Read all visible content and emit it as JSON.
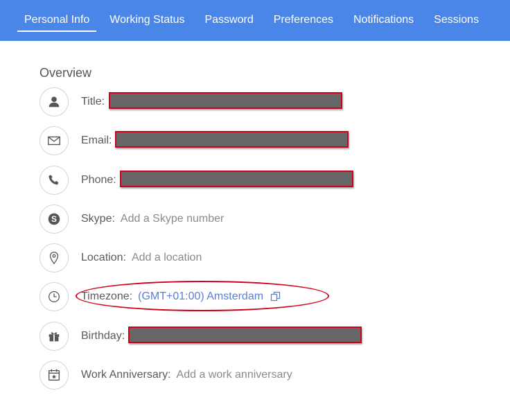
{
  "tabs": [
    {
      "label": "Personal Info",
      "active": true
    },
    {
      "label": "Working Status",
      "active": false
    },
    {
      "label": "Password",
      "active": false
    },
    {
      "label": "Preferences",
      "active": false
    },
    {
      "label": "Notifications",
      "active": false
    },
    {
      "label": "Sessions",
      "active": false
    }
  ],
  "overview": {
    "title": "Overview",
    "rows": {
      "title": {
        "label": "Title:",
        "icon": "person-icon"
      },
      "email": {
        "label": "Email:",
        "icon": "envelope-icon"
      },
      "phone": {
        "label": "Phone:",
        "icon": "phone-icon"
      },
      "skype": {
        "label": "Skype:",
        "value": "Add a Skype number",
        "icon": "skype-icon"
      },
      "location": {
        "label": "Location:",
        "value": "Add a location",
        "icon": "location-pin-icon"
      },
      "timezone": {
        "label": "Timezone:",
        "value": "(GMT+01:00) Amsterdam",
        "icon": "clock-icon"
      },
      "birthday": {
        "label": "Birthday:",
        "icon": "gift-icon"
      },
      "anniversary": {
        "label": "Work Anniversary:",
        "value": "Add a work anniversary",
        "icon": "calendar-star-icon"
      }
    }
  },
  "colors": {
    "accent": "#4a86e8",
    "link": "#5b7fd6",
    "annotation": "#d0021b",
    "redaction": "#666666"
  }
}
